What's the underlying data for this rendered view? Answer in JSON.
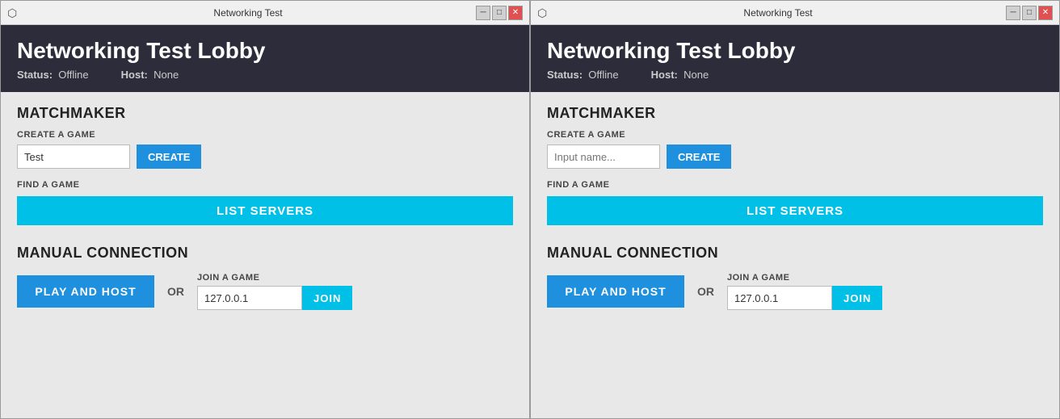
{
  "windows": [
    {
      "id": "window-left",
      "titlebar": {
        "title": "Networking Test",
        "minimize_label": "─",
        "restore_label": "□",
        "close_label": "✕"
      },
      "header": {
        "title": "Networking Test Lobby",
        "status_label": "Status:",
        "status_value": "Offline",
        "host_label": "Host:",
        "host_value": "None"
      },
      "matchmaker": {
        "section_title": "MATCHMAKER",
        "create_label": "CREATE A GAME",
        "create_input_value": "Test",
        "create_input_placeholder": "",
        "create_button": "CREATE",
        "find_label": "FIND A GAME",
        "list_servers_button": "LIST SERVERS"
      },
      "manual": {
        "section_title": "MANUAL CONNECTION",
        "play_host_button": "PLAY AND HOST",
        "or_text": "OR",
        "join_label": "JOIN A GAME",
        "ip_value": "127.0.0.1",
        "join_button": "JOIN"
      }
    },
    {
      "id": "window-right",
      "titlebar": {
        "title": "Networking Test",
        "minimize_label": "─",
        "restore_label": "□",
        "close_label": "✕"
      },
      "header": {
        "title": "Networking Test Lobby",
        "status_label": "Status:",
        "status_value": "Offline",
        "host_label": "Host:",
        "host_value": "None"
      },
      "matchmaker": {
        "section_title": "MATCHMAKER",
        "create_label": "CREATE A GAME",
        "create_input_value": "",
        "create_input_placeholder": "Input name...",
        "create_button": "CREATE",
        "find_label": "FIND A GAME",
        "list_servers_button": "LIST SERVERS"
      },
      "manual": {
        "section_title": "MANUAL CONNECTION",
        "play_host_button": "PLAY AND HOST",
        "or_text": "OR",
        "join_label": "JOIN A GAME",
        "ip_value": "127.0.0.1",
        "join_button": "JOIN"
      }
    }
  ]
}
